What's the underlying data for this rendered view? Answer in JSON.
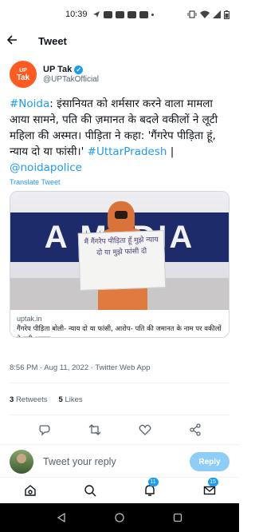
{
  "status_bar": {
    "time": "10:39",
    "left_icons": [
      "send-icon",
      "square-icon",
      "youtube-icon",
      "youtube-icon",
      "youtube-icon"
    ],
    "right_icons": [
      "notification-dot",
      "vibrate-icon",
      "wifi-icon",
      "signal-icon",
      "battery-icon"
    ]
  },
  "header": {
    "back_icon": "arrow-left-icon",
    "title": "Tweet"
  },
  "author": {
    "avatar_text_top": "UP",
    "avatar_text_bottom": "Tak",
    "name": "UP Tak",
    "verified": true,
    "handle": "@UPTakOfficial"
  },
  "tweet": {
    "hashtag_noida": "#Noida",
    "body": ": इंसानियत को शर्मसार करने वाला मामला आया सामने, पति की ज़मानत के बदले वकीलों ने लूटी महिला की अस्मत। पीड़िता ने कहा: 'गैंगरेप पीड़िता हूं, न्याय दो या फांसी।' ",
    "hashtag_up": "#UttarPradesh",
    "separator": " | ",
    "mention": "@noidapolice",
    "translate_label": "Translate Tweet"
  },
  "card": {
    "banner_text": "A MEDIA",
    "placard_text": "मैं गैंगरेप पीड़िता हूँ मुझे न्याय दो या मुझे फांसी दो",
    "domain": "uptak.in",
    "title": "गैंगरेप पीड़िता बोली- न्याय दो या फांसी, आरोप- पति की जमानत के नाम पर वकीलों ने लूटी अस्मत"
  },
  "meta": {
    "text": "8:56 PM · Aug 11, 2022 · Twitter Web App"
  },
  "stats": {
    "retweets_count": "3",
    "retweets_label": "Retweets",
    "likes_count": "5",
    "likes_label": "Likes"
  },
  "actions": [
    "reply-icon",
    "retweet-icon",
    "like-icon",
    "share-icon"
  ],
  "reply": {
    "placeholder": "Tweet your reply",
    "button_label": "Reply"
  },
  "bottom_nav": {
    "items": [
      "home-icon",
      "search-icon",
      "notifications-icon",
      "messages-icon"
    ],
    "notifications_badge": "11",
    "messages_badge": "15"
  },
  "colors": {
    "accent": "#1d9bf0",
    "reply_button_disabled": "#8ecdf8",
    "uptak_orange": "#ff5a1f"
  }
}
